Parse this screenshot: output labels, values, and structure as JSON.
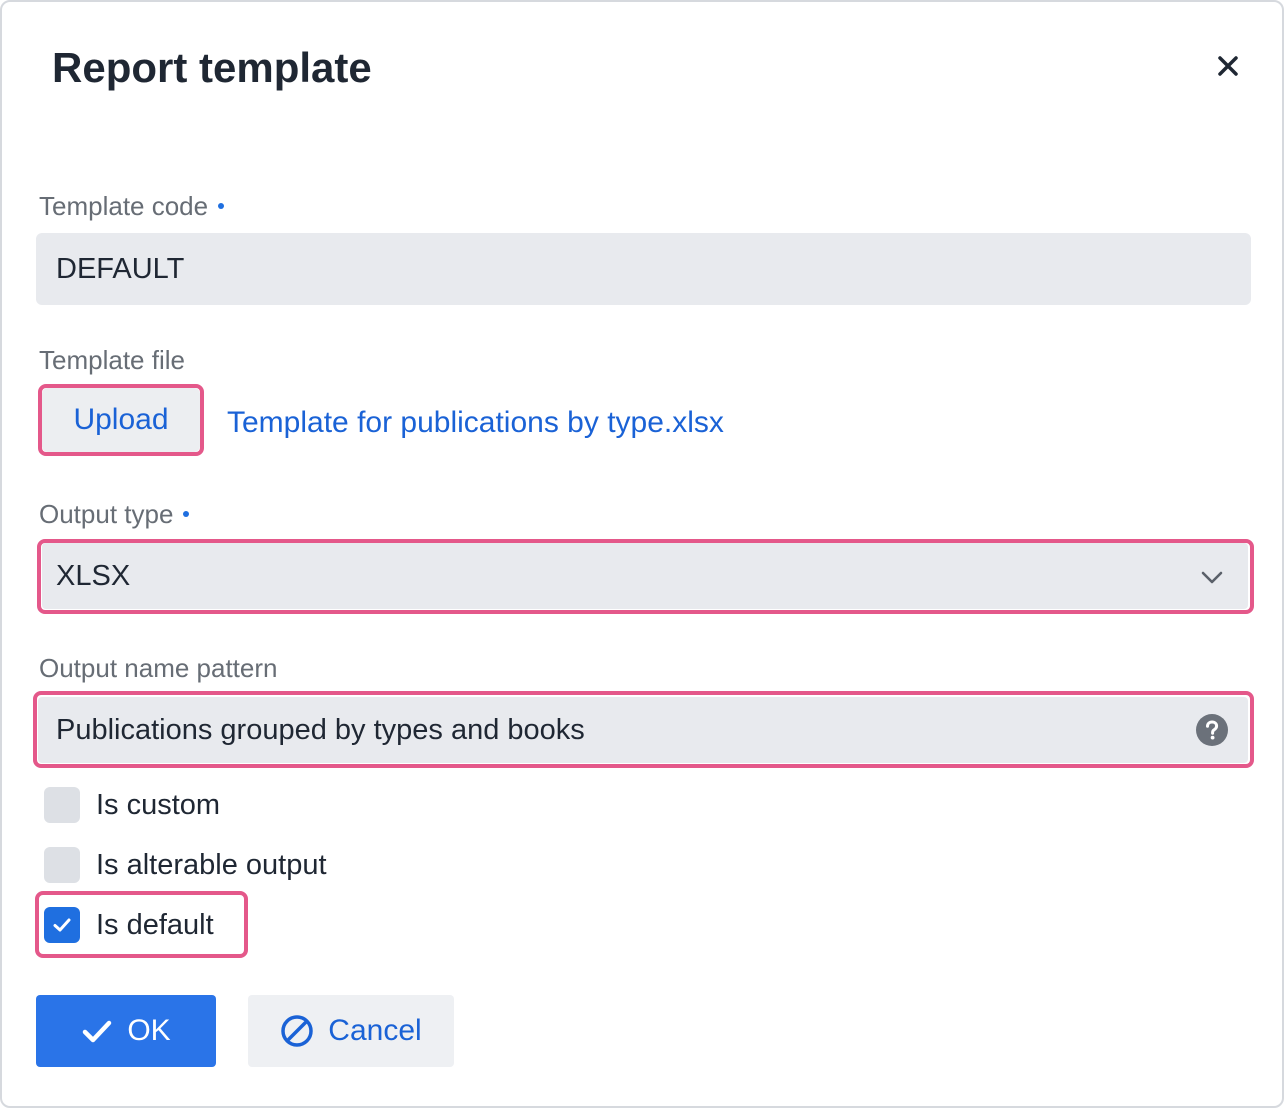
{
  "dialog": {
    "title": "Report template",
    "close_icon": "close-icon"
  },
  "fields": {
    "template_code": {
      "label": "Template code",
      "required": true,
      "value": "DEFAULT"
    },
    "template_file": {
      "label": "Template file",
      "upload_label": "Upload",
      "file_name": "Template for publications by type.xlsx"
    },
    "output_type": {
      "label": "Output type",
      "required": true,
      "value": "XLSX",
      "icon": "chevron-down-icon"
    },
    "output_name_pattern": {
      "label": "Output name pattern",
      "value": "Publications grouped by types and books",
      "icon": "help-circle-icon"
    }
  },
  "checkboxes": [
    {
      "label": "Is custom",
      "checked": false
    },
    {
      "label": "Is alterable output",
      "checked": false
    },
    {
      "label": "Is default",
      "checked": true
    }
  ],
  "actions": {
    "ok_label": "OK",
    "ok_icon": "checkmark-icon",
    "cancel_label": "Cancel",
    "cancel_icon": "forbidden-icon"
  },
  "colors": {
    "accent": "#2a74e8",
    "link": "#1a62d6",
    "highlight": "#e4588a",
    "required_dot": "#1f6fe0"
  }
}
